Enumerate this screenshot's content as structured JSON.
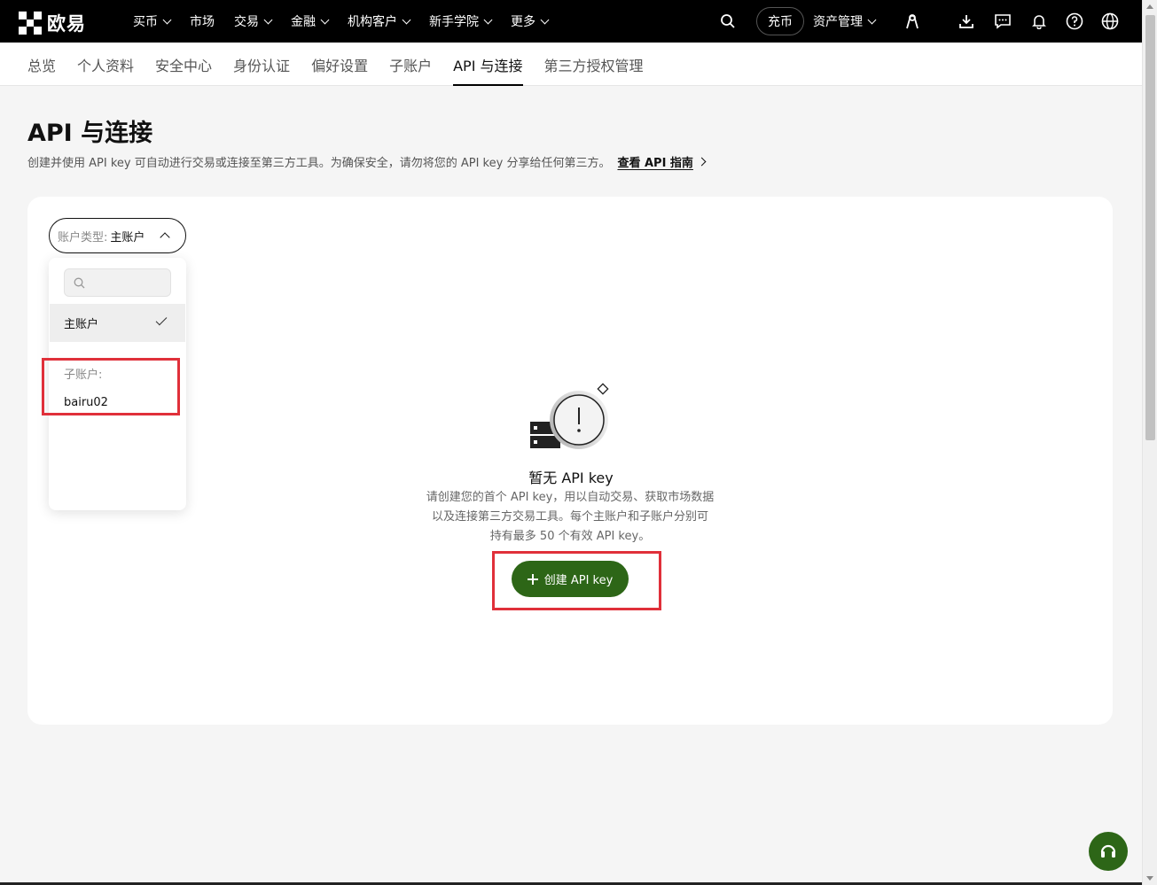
{
  "brand": {
    "name": "欧易"
  },
  "nav": {
    "items": [
      {
        "label": "买币",
        "dropdown": true
      },
      {
        "label": "市场",
        "dropdown": false
      },
      {
        "label": "交易",
        "dropdown": true
      },
      {
        "label": "金融",
        "dropdown": true
      },
      {
        "label": "机构客户",
        "dropdown": true
      },
      {
        "label": "新手学院",
        "dropdown": true
      },
      {
        "label": "更多",
        "dropdown": true
      }
    ],
    "deposit_label": "充币",
    "asset_label": "资产管理"
  },
  "subnav": {
    "tabs": [
      "总览",
      "个人资料",
      "安全中心",
      "身份认证",
      "偏好设置",
      "子账户",
      "API 与连接",
      "第三方授权管理"
    ],
    "active": "API 与连接"
  },
  "page": {
    "title": "API 与连接",
    "description": "创建并使用 API key 可自动进行交易或连接至第三方工具。为确保安全，请勿将您的 API key 分享给任何第三方。",
    "guide_link": "查看 API 指南"
  },
  "account_select": {
    "label": "账户类型:",
    "value": "主账户"
  },
  "dropdown": {
    "search_value": "",
    "main_option": "主账户",
    "sub_group_label": "子账户:",
    "sub_options": [
      "bairu02"
    ]
  },
  "empty_state": {
    "title": "暂无 API key",
    "desc_line1": "请创建您的首个 API key，用以自动交易、获取市场数据",
    "desc_line2": "以及连接第三方交易工具。每个主账户和子账户分别可",
    "desc_line3": "持有最多 50 个有效 API key。",
    "create_button": "创建 API key"
  },
  "colors": {
    "accent_green": "#2d6617",
    "highlight_red": "#e0303a",
    "topbar_bg": "#000000"
  }
}
